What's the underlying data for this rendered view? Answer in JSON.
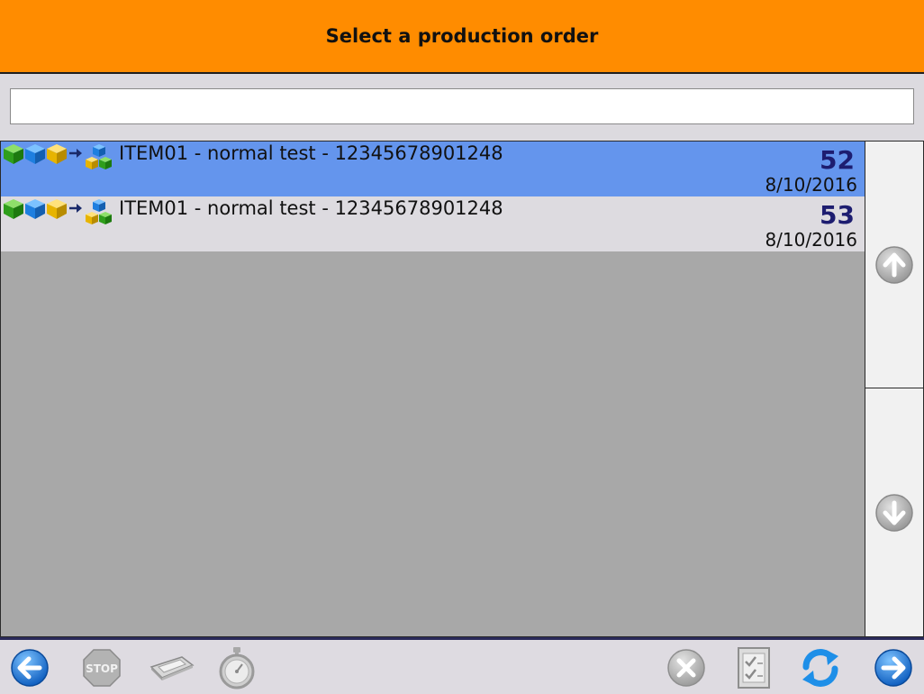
{
  "header": {
    "title": "Select a production order"
  },
  "search": {
    "value": "",
    "placeholder": ""
  },
  "orders": [
    {
      "label": "ITEM01 - normal test - 12345678901248",
      "number": "52",
      "date": "8/10/2016",
      "selected": true
    },
    {
      "label": "ITEM01 - normal test - 12345678901248",
      "number": "53",
      "date": "8/10/2016",
      "selected": false
    }
  ],
  "row_icons": [
    "green-cube-icon",
    "blue-cube-icon",
    "yellow-cube-icon",
    "arrow-right-icon",
    "cube-stack-icon"
  ],
  "scroll": {
    "up_icon": "arrow-up-icon",
    "down_icon": "arrow-down-icon"
  },
  "toolbar": {
    "left": [
      "back-arrow-icon",
      "stop-sign-icon",
      "card-reader-icon",
      "stopwatch-icon"
    ],
    "right": [
      "cancel-x-icon",
      "checklist-icon",
      "refresh-icon",
      "forward-arrow-icon"
    ]
  },
  "colors": {
    "header": "#ff8c00",
    "selected_row": "#6495ed",
    "number_text": "#1d1d70",
    "nav_blue": "#1e7fe0"
  }
}
